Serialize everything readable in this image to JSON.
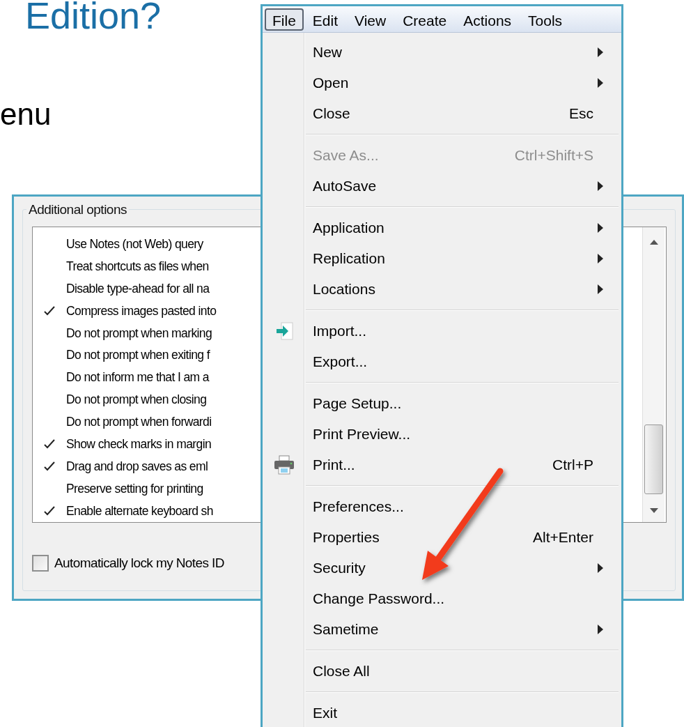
{
  "slide": {
    "title": "Edition?",
    "text_fragment": "enu"
  },
  "dialog": {
    "group_label": "Additional options",
    "options": [
      {
        "label": "Use Notes (not Web) query",
        "checked": false
      },
      {
        "label": "Treat shortcuts as files when",
        "checked": false
      },
      {
        "label": "Disable type-ahead for all na",
        "checked": false
      },
      {
        "label": "Compress images pasted into",
        "checked": true
      },
      {
        "label": "Do not prompt when marking",
        "checked": false
      },
      {
        "label": "Do not prompt when exiting f",
        "checked": false
      },
      {
        "label": "Do not inform me that I am a",
        "checked": false
      },
      {
        "label": "Do not prompt when closing",
        "checked": false
      },
      {
        "label": "Do not prompt when forwardi",
        "checked": false
      },
      {
        "label": "Show check marks in margin",
        "checked": true
      },
      {
        "label": "Drag and drop saves as eml",
        "checked": true
      },
      {
        "label": "Preserve setting for printing",
        "checked": false
      },
      {
        "label": "Enable alternate keyboard sh",
        "checked": true
      }
    ],
    "lock_checkbox": {
      "label": "Automatically lock my Notes ID",
      "checked": false
    }
  },
  "menu": {
    "bar": [
      {
        "label": "File",
        "selected": true
      },
      {
        "label": "Edit",
        "selected": false
      },
      {
        "label": "View",
        "selected": false
      },
      {
        "label": "Create",
        "selected": false
      },
      {
        "label": "Actions",
        "selected": false
      },
      {
        "label": "Tools",
        "selected": false
      }
    ],
    "items": [
      {
        "kind": "item",
        "label": "New",
        "submenu": true,
        "disabled": false
      },
      {
        "kind": "item",
        "label": "Open",
        "submenu": true,
        "disabled": false
      },
      {
        "kind": "item",
        "label": "Close",
        "shortcut": "Esc",
        "submenu": false,
        "disabled": false
      },
      {
        "kind": "separator"
      },
      {
        "kind": "item",
        "label": "Save As...",
        "shortcut": "Ctrl+Shift+S",
        "submenu": false,
        "disabled": true
      },
      {
        "kind": "item",
        "label": "AutoSave",
        "submenu": true,
        "disabled": false
      },
      {
        "kind": "separator"
      },
      {
        "kind": "item",
        "label": "Application",
        "submenu": true,
        "disabled": false
      },
      {
        "kind": "item",
        "label": "Replication",
        "submenu": true,
        "disabled": false
      },
      {
        "kind": "item",
        "label": "Locations",
        "submenu": true,
        "disabled": false
      },
      {
        "kind": "separator"
      },
      {
        "kind": "import",
        "label": "Import...",
        "submenu": false,
        "disabled": false
      },
      {
        "kind": "item",
        "label": "Export...",
        "submenu": false,
        "disabled": false
      },
      {
        "kind": "separator"
      },
      {
        "kind": "item",
        "label": "Page Setup...",
        "submenu": false,
        "disabled": false
      },
      {
        "kind": "item",
        "label": "Print Preview...",
        "submenu": false,
        "disabled": false
      },
      {
        "kind": "print",
        "label": "Print...",
        "shortcut": "Ctrl+P",
        "submenu": false,
        "disabled": false
      },
      {
        "kind": "separator"
      },
      {
        "kind": "item",
        "label": "Preferences...",
        "submenu": false,
        "disabled": false
      },
      {
        "kind": "item",
        "label": "Properties",
        "shortcut": "Alt+Enter",
        "submenu": false,
        "disabled": false
      },
      {
        "kind": "item",
        "label": "Security",
        "submenu": true,
        "disabled": false
      },
      {
        "kind": "item",
        "label": "Change Password...",
        "submenu": false,
        "disabled": false
      },
      {
        "kind": "item",
        "label": "Sametime",
        "submenu": true,
        "disabled": false
      },
      {
        "kind": "separator"
      },
      {
        "kind": "item",
        "label": "Close All",
        "submenu": false,
        "disabled": false
      },
      {
        "kind": "separator"
      },
      {
        "kind": "item",
        "label": "Exit",
        "submenu": false,
        "disabled": false
      }
    ]
  }
}
